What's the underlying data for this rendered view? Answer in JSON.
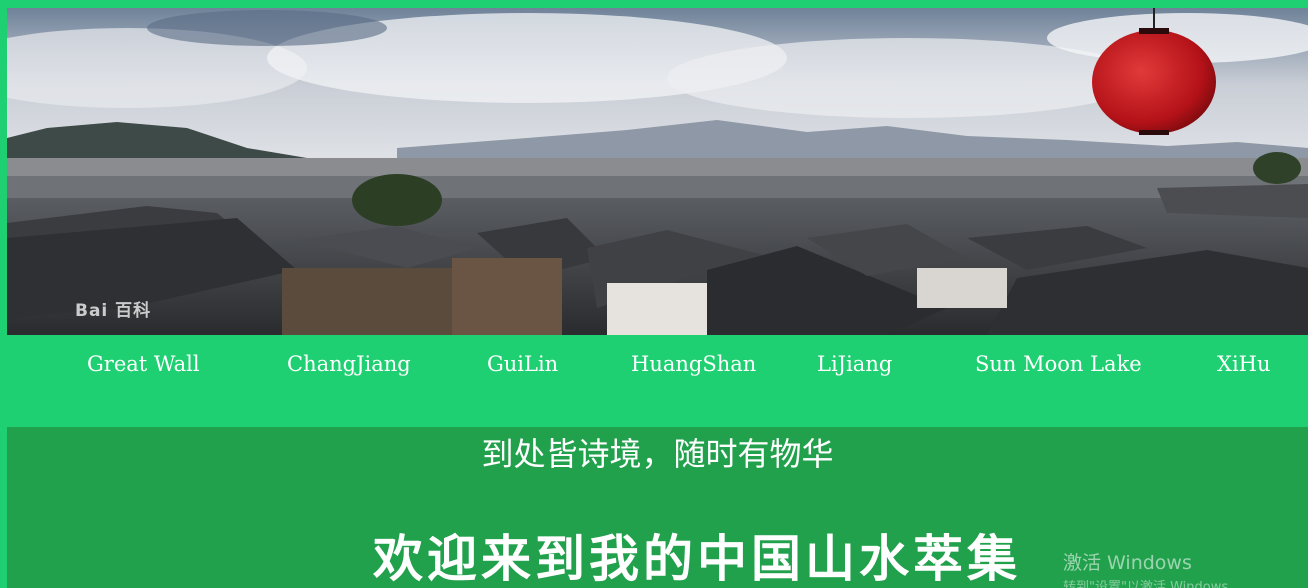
{
  "banner": {
    "watermark": "Bai 百科"
  },
  "nav": {
    "items": [
      {
        "label": "Great Wall"
      },
      {
        "label": "ChangJiang"
      },
      {
        "label": "GuiLin"
      },
      {
        "label": "HuangShan"
      },
      {
        "label": "LiJiang"
      },
      {
        "label": "Sun Moon Lake"
      },
      {
        "label": "XiHu"
      }
    ]
  },
  "content": {
    "motto": "到处皆诗境，随时有物华",
    "welcome": "欢迎来到我的中国山水萃集"
  },
  "system": {
    "activation_title": "激活 Windows",
    "activation_sub": "转到\"设置\"以激活 Windows。"
  },
  "colors": {
    "page_background": "#1fd072",
    "content_background": "#22a14d",
    "lantern": "#c8141b"
  }
}
